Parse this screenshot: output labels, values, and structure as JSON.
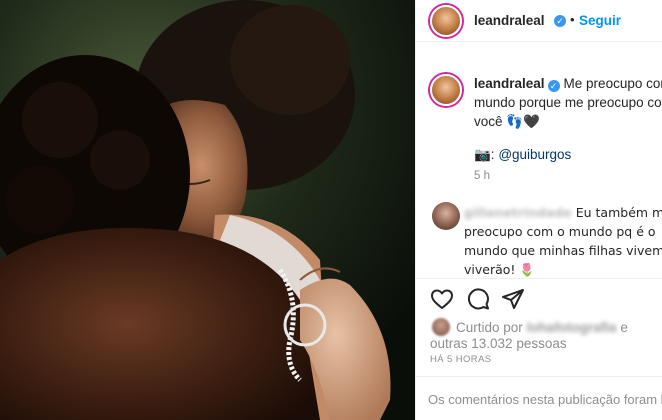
{
  "post": {
    "username": "leandraleal",
    "verified_badge": "✓",
    "separator": "•",
    "follow_label": "Seguir",
    "caption_line1": "Me preocupo com o",
    "caption_line2": "mundo porque me preocupo com",
    "caption_line3": "você 👣🖤",
    "credit_prefix": "📷: ",
    "credit_mention": "@guiburgos",
    "caption_time": "5 h"
  },
  "comment": {
    "username": "gillanetrindade",
    "text_line1": "Eu também me",
    "text_line2": "preocupo com o mundo pq é o",
    "text_line3": "mundo que minhas filhas vivem e",
    "text_line4": "viverão! 🌷"
  },
  "actions": {
    "like_icon": "heart-icon",
    "comment_icon": "comment-icon",
    "share_icon": "share-icon"
  },
  "likes": {
    "prefix": "Curtido por",
    "user": "lohafotografia",
    "suffix": "e",
    "others": "outras 13.032 pessoas"
  },
  "posted_ago": "HÁ 5 HORAS",
  "footer": {
    "comments_disabled": "Os comentários nesta publicação foram lim"
  },
  "colors": {
    "link_blue": "#0095f6",
    "verified_blue": "#3897f0",
    "muted": "#8e8e8e",
    "text": "#262626"
  }
}
